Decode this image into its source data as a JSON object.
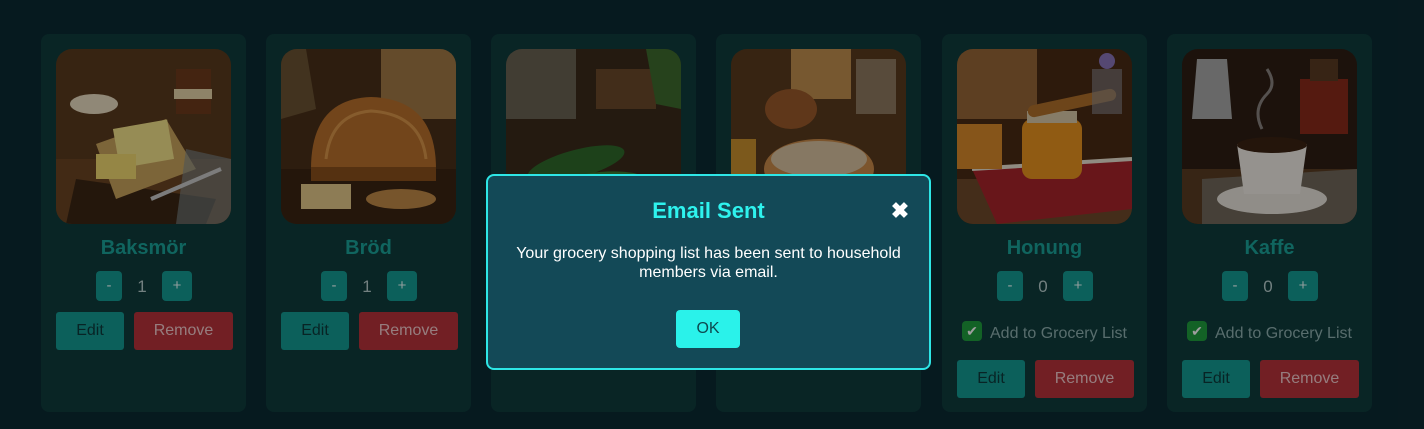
{
  "cards": [
    {
      "name": "Baksmör",
      "qty": "1",
      "edit_label": "Edit",
      "remove_label": "Remove"
    },
    {
      "name": "Bröd",
      "qty": "1",
      "edit_label": "Edit",
      "remove_label": "Remove"
    },
    {
      "name": "",
      "qty": "",
      "edit_label": "",
      "remove_label": ""
    },
    {
      "name": "",
      "qty": "",
      "edit_label": "",
      "remove_label": ""
    },
    {
      "name": "Honung",
      "qty": "0",
      "checkbox_label": "Add to Grocery List",
      "checked": true,
      "edit_label": "Edit",
      "remove_label": "Remove"
    },
    {
      "name": "Kaffe",
      "qty": "0",
      "checkbox_label": "Add to Grocery List",
      "checked": true,
      "edit_label": "Edit",
      "remove_label": "Remove"
    }
  ],
  "stepper": {
    "minus": "-",
    "plus": "+"
  },
  "modal": {
    "title": "Email Sent",
    "close_glyph": "✖",
    "message": "Your grocery shopping list has been sent to household members via email.",
    "ok_label": "OK"
  },
  "colors": {
    "accent": "#1aa39a",
    "modal_border": "#2ee6e6",
    "remove": "#b8333a",
    "ok": "#2af2ea"
  },
  "icons": {
    "checkbox": "check-icon",
    "close": "close-icon"
  }
}
